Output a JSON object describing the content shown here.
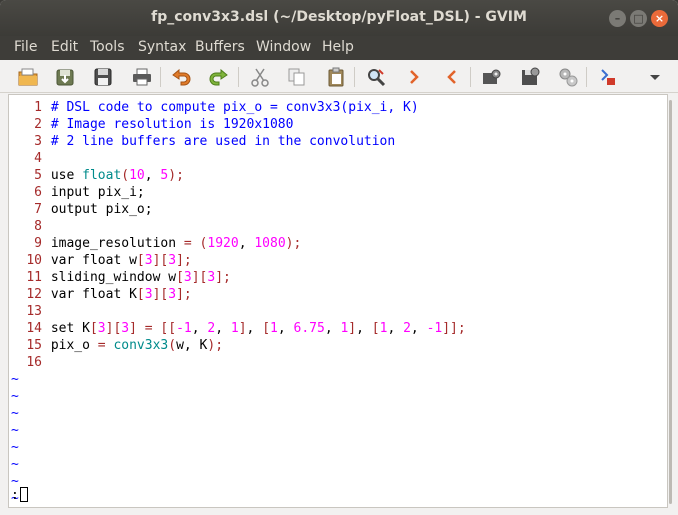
{
  "window": {
    "title": "fp_conv3x3.dsl (~/Desktop/pyFloat_DSL) - GVIM",
    "controls": {
      "minimize": "–",
      "maximize": "□",
      "close": "×"
    }
  },
  "menu": [
    "File",
    "Edit",
    "Tools",
    "Syntax",
    "Buffers",
    "Window",
    "Help"
  ],
  "toolbar": {
    "icons": [
      "open-icon",
      "save-as-icon",
      "save-icon",
      "print-icon",
      "undo-icon",
      "redo-icon",
      "cut-icon",
      "copy-icon",
      "paste-icon",
      "find-replace-icon",
      "find-next-icon",
      "find-previous-icon",
      "load-session-icon",
      "save-session-icon",
      "run-script-icon",
      "make-icon",
      "overflow-menu-icon"
    ]
  },
  "editor": {
    "lines": [
      {
        "num": "1",
        "segments": [
          {
            "t": "# DSL code to compute pix_o = conv3x3(pix_i, K)",
            "c": "c"
          }
        ]
      },
      {
        "num": "2",
        "segments": [
          {
            "t": "# Image resolution is 1920x1080",
            "c": "c"
          }
        ]
      },
      {
        "num": "3",
        "segments": [
          {
            "t": "# 2 line buffers are used in the convolution",
            "c": "c"
          }
        ]
      },
      {
        "num": "4",
        "segments": []
      },
      {
        "num": "5",
        "segments": [
          {
            "t": "use ",
            "c": ""
          },
          {
            "t": "float",
            "c": "t"
          },
          {
            "t": "(",
            "c": "r"
          },
          {
            "t": "10",
            "c": "n"
          },
          {
            "t": ", ",
            "c": ""
          },
          {
            "t": "5",
            "c": "n"
          },
          {
            "t": ");",
            "c": "r"
          }
        ]
      },
      {
        "num": "6",
        "segments": [
          {
            "t": "input pix_i;",
            "c": ""
          }
        ]
      },
      {
        "num": "7",
        "segments": [
          {
            "t": "output pix_o;",
            "c": ""
          }
        ]
      },
      {
        "num": "8",
        "segments": []
      },
      {
        "num": "9",
        "segments": [
          {
            "t": "image_resolution ",
            "c": ""
          },
          {
            "t": "=",
            "c": "r"
          },
          {
            "t": " ",
            "c": ""
          },
          {
            "t": "(",
            "c": "r"
          },
          {
            "t": "1920",
            "c": "n"
          },
          {
            "t": ", ",
            "c": ""
          },
          {
            "t": "1080",
            "c": "n"
          },
          {
            "t": ");",
            "c": "r"
          }
        ]
      },
      {
        "num": "10",
        "segments": [
          {
            "t": "var float w",
            "c": ""
          },
          {
            "t": "[",
            "c": "r"
          },
          {
            "t": "3",
            "c": "n"
          },
          {
            "t": "][",
            "c": "r"
          },
          {
            "t": "3",
            "c": "n"
          },
          {
            "t": "];",
            "c": "r"
          }
        ]
      },
      {
        "num": "11",
        "segments": [
          {
            "t": "sliding_window w",
            "c": ""
          },
          {
            "t": "[",
            "c": "r"
          },
          {
            "t": "3",
            "c": "n"
          },
          {
            "t": "][",
            "c": "r"
          },
          {
            "t": "3",
            "c": "n"
          },
          {
            "t": "];",
            "c": "r"
          }
        ]
      },
      {
        "num": "12",
        "segments": [
          {
            "t": "var float K",
            "c": ""
          },
          {
            "t": "[",
            "c": "r"
          },
          {
            "t": "3",
            "c": "n"
          },
          {
            "t": "][",
            "c": "r"
          },
          {
            "t": "3",
            "c": "n"
          },
          {
            "t": "];",
            "c": "r"
          }
        ]
      },
      {
        "num": "13",
        "segments": []
      },
      {
        "num": "14",
        "segments": [
          {
            "t": "set K",
            "c": ""
          },
          {
            "t": "[",
            "c": "r"
          },
          {
            "t": "3",
            "c": "n"
          },
          {
            "t": "][",
            "c": "r"
          },
          {
            "t": "3",
            "c": "n"
          },
          {
            "t": "]",
            "c": "r"
          },
          {
            "t": " ",
            "c": ""
          },
          {
            "t": "=",
            "c": "r"
          },
          {
            "t": " ",
            "c": ""
          },
          {
            "t": "[[",
            "c": "r"
          },
          {
            "t": "-1",
            "c": "n"
          },
          {
            "t": ", ",
            "c": ""
          },
          {
            "t": "2",
            "c": "n"
          },
          {
            "t": ", ",
            "c": ""
          },
          {
            "t": "1",
            "c": "n"
          },
          {
            "t": "]",
            "c": "r"
          },
          {
            "t": ", ",
            "c": ""
          },
          {
            "t": "[",
            "c": "r"
          },
          {
            "t": "1",
            "c": "n"
          },
          {
            "t": ", ",
            "c": ""
          },
          {
            "t": "6.75",
            "c": "n"
          },
          {
            "t": ", ",
            "c": ""
          },
          {
            "t": "1",
            "c": "n"
          },
          {
            "t": "]",
            "c": "r"
          },
          {
            "t": ", ",
            "c": ""
          },
          {
            "t": "[",
            "c": "r"
          },
          {
            "t": "1",
            "c": "n"
          },
          {
            "t": ", ",
            "c": ""
          },
          {
            "t": "2",
            "c": "n"
          },
          {
            "t": ", ",
            "c": ""
          },
          {
            "t": "-1",
            "c": "n"
          },
          {
            "t": "]];",
            "c": "r"
          }
        ]
      },
      {
        "num": "15",
        "segments": [
          {
            "t": "pix_o ",
            "c": ""
          },
          {
            "t": "=",
            "c": "r"
          },
          {
            "t": " ",
            "c": ""
          },
          {
            "t": "conv3x3",
            "c": "t"
          },
          {
            "t": "(",
            "c": "r"
          },
          {
            "t": "w, K",
            "c": ""
          },
          {
            "t": ");",
            "c": "r"
          }
        ]
      },
      {
        "num": "16",
        "segments": []
      }
    ],
    "empty_marker": "~",
    "empty_lines": 8,
    "command_line": ":"
  },
  "colors": {
    "comment": "#0000ff",
    "type": "#008b8b",
    "number": "#ff00ff",
    "line_number": "#a52a2a",
    "title_bar": "#3c3b37",
    "close_button": "#ea6a3a"
  }
}
